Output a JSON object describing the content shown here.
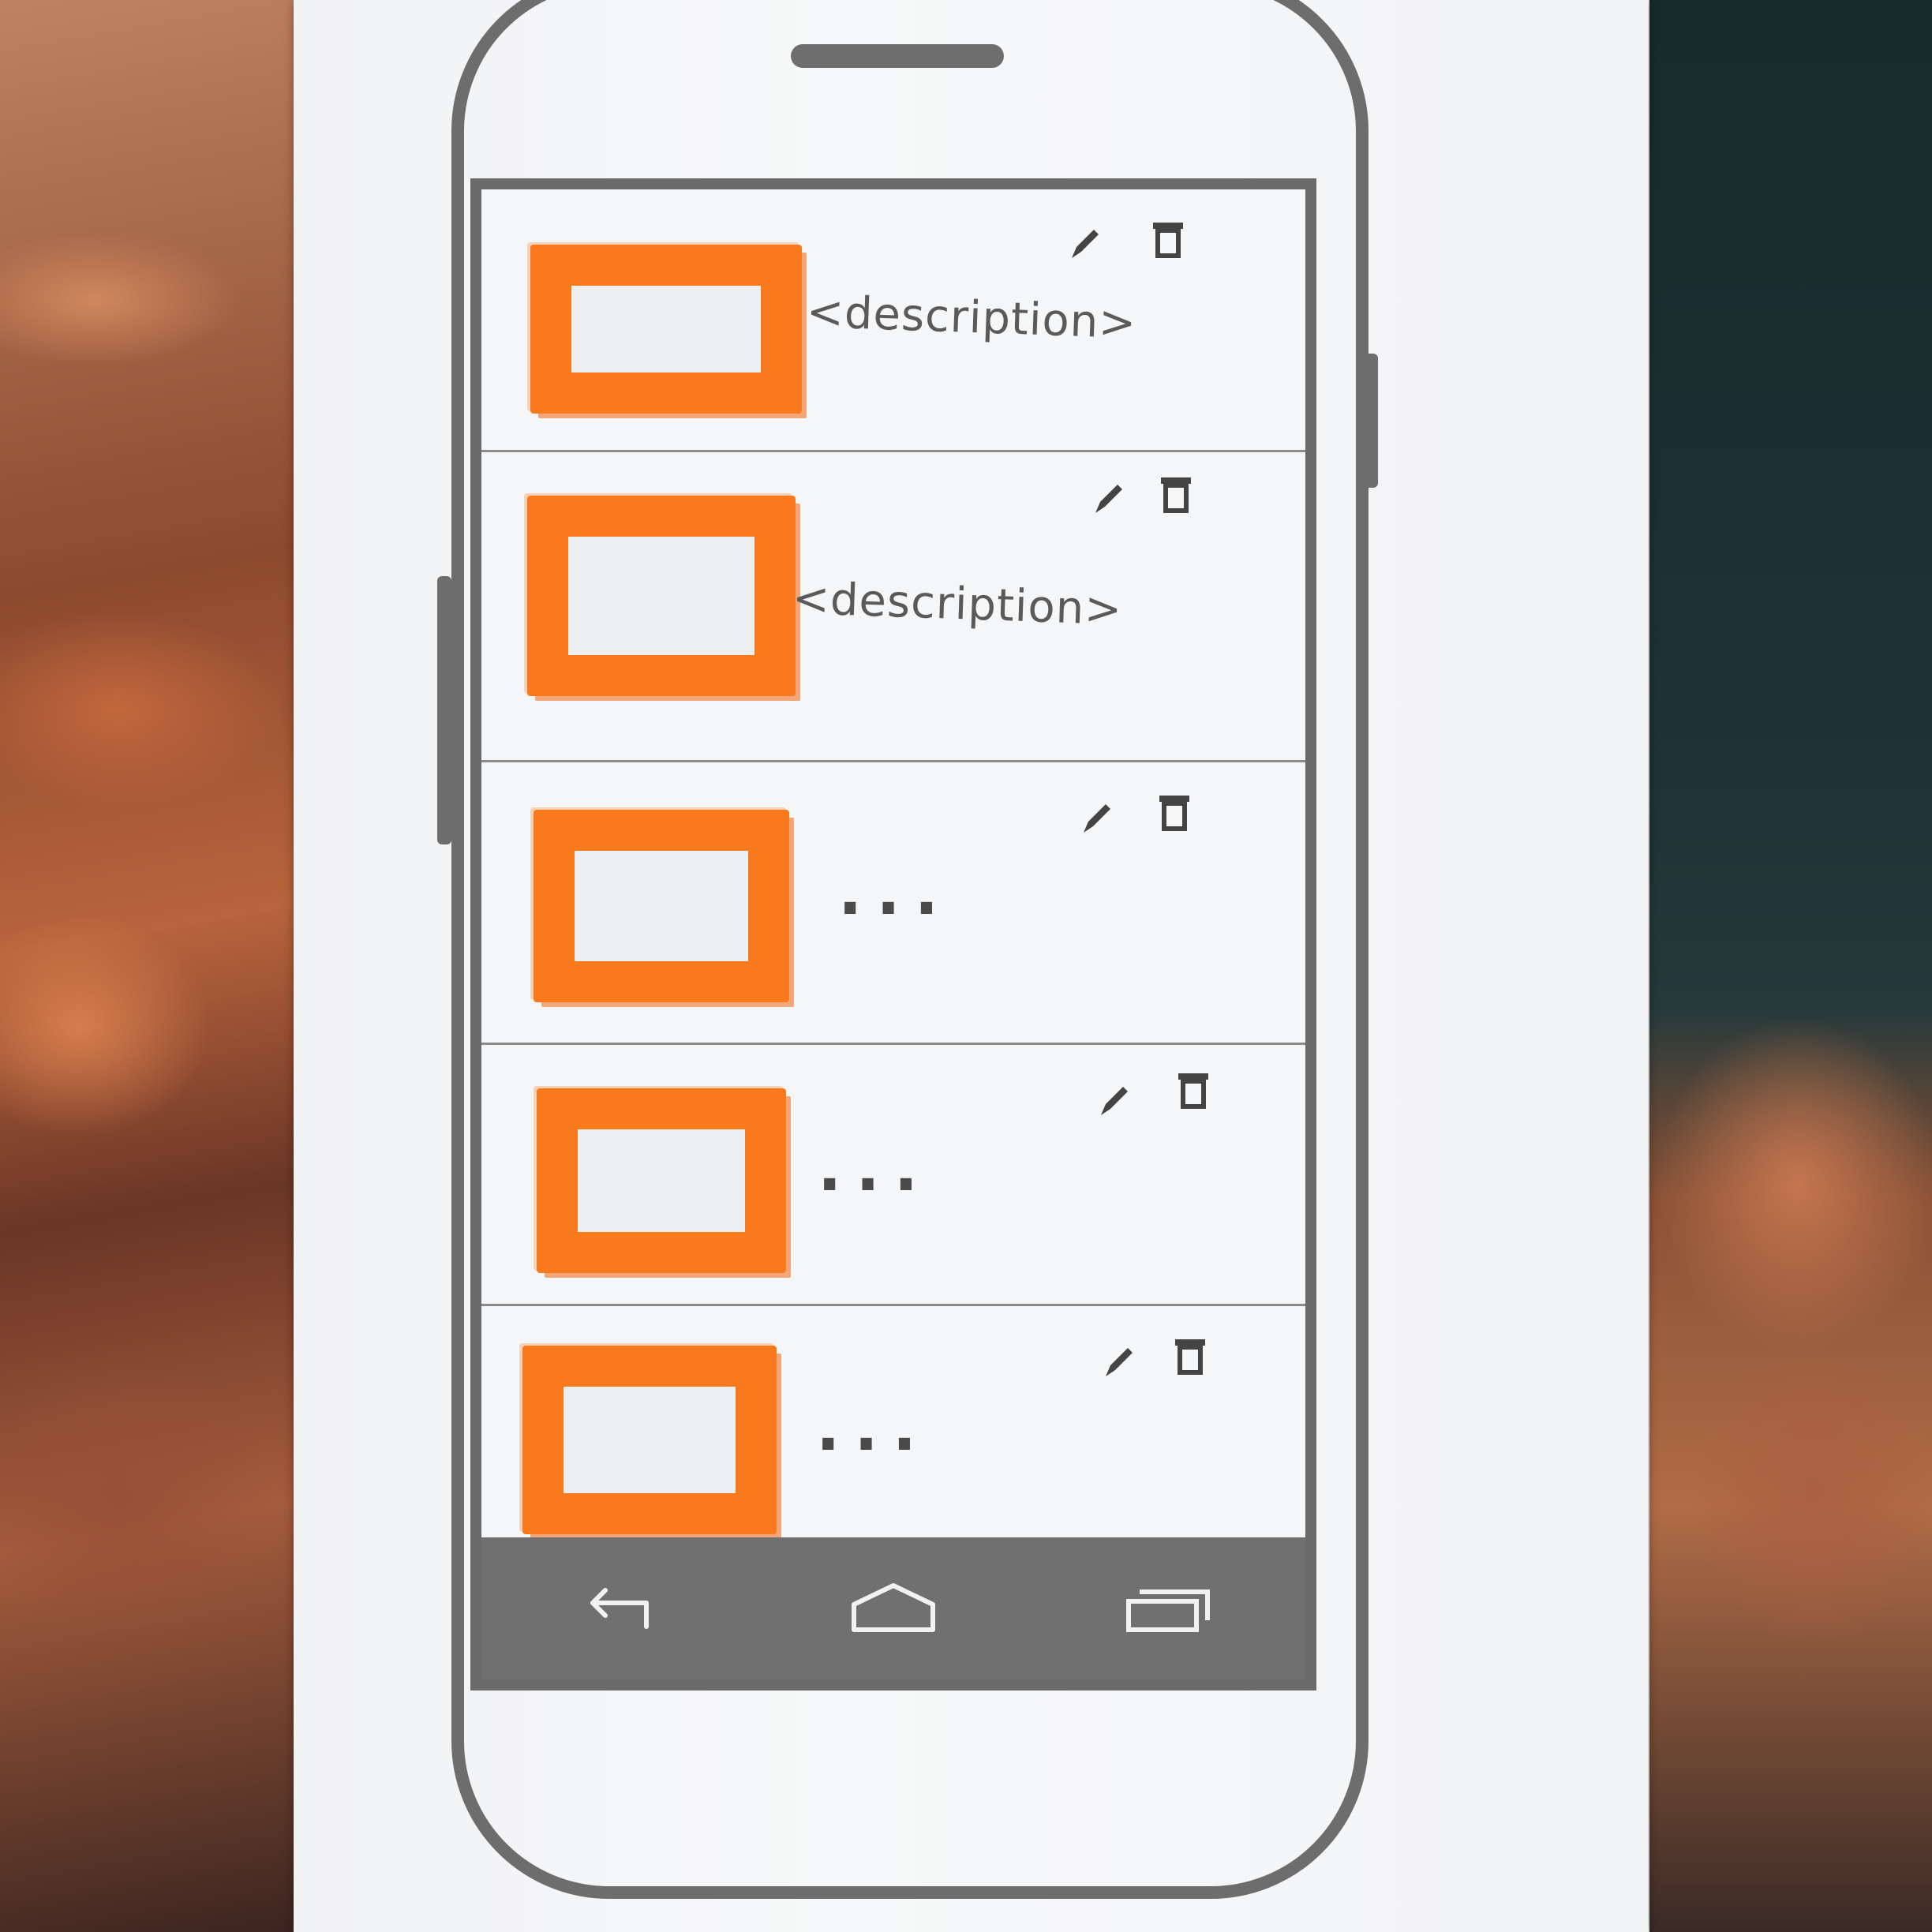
{
  "colors": {
    "thumbnail_border": "#f97a1c",
    "phone_frame": "#6d6d6d",
    "nav_bar": "#707070",
    "pencil": "#4a4a4a"
  },
  "list": {
    "items": [
      {
        "description": "<description>",
        "edit_icon": "pencil-icon",
        "delete_icon": "trash-icon"
      },
      {
        "description": "<description>",
        "edit_icon": "pencil-icon",
        "delete_icon": "trash-icon"
      },
      {
        "description": "...",
        "edit_icon": "pencil-icon",
        "delete_icon": "trash-icon"
      },
      {
        "description": "...",
        "edit_icon": "pencil-icon",
        "delete_icon": "trash-icon"
      },
      {
        "description": "...",
        "edit_icon": "pencil-icon",
        "delete_icon": "trash-icon"
      }
    ]
  },
  "nav_bar": {
    "buttons": [
      "back-icon",
      "home-icon",
      "recents-icon"
    ]
  }
}
